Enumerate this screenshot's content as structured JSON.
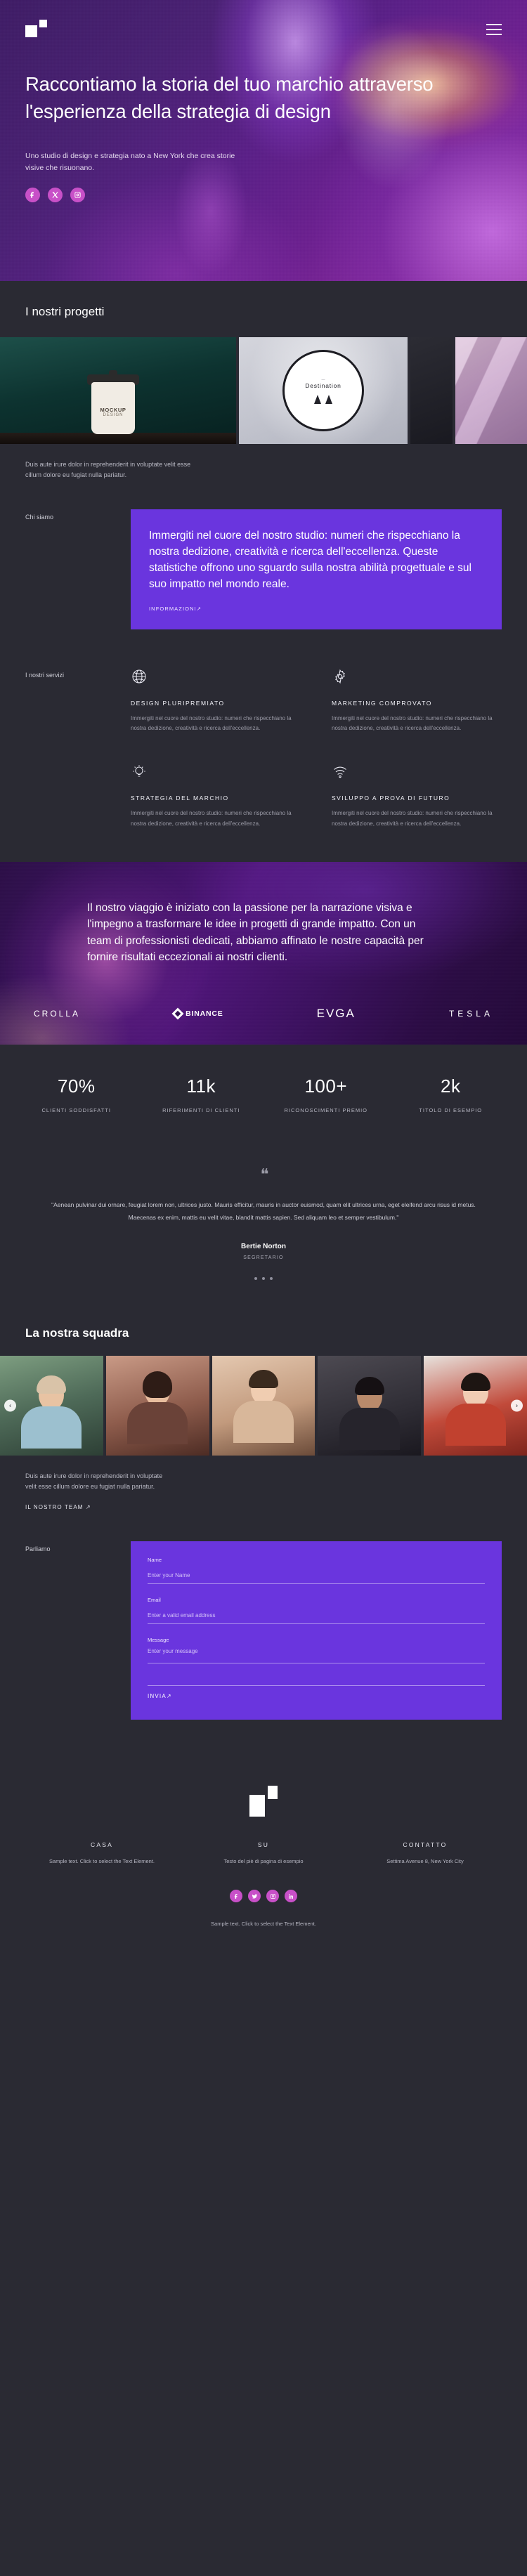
{
  "brand": {
    "logo_name": "studio-logo-mark"
  },
  "nav": {
    "menu_icon": "hamburger-menu-icon"
  },
  "hero": {
    "title": "Raccontiamo la storia del tuo marchio attraverso l'esperienza della strategia di design",
    "subtitle": "Uno studio di design e strategia nato a New York che crea storie visive che risuonano.",
    "socials": [
      {
        "name": "facebook-icon",
        "label": "Facebook"
      },
      {
        "name": "x-twitter-icon",
        "label": "X"
      },
      {
        "name": "instagram-icon",
        "label": "Instagram"
      }
    ]
  },
  "projects": {
    "heading": "I nostri progetti",
    "note": "Duis aute irure dolor in reprehenderit in voluptate velit esse cillum dolore eu fugiat nulla pariatur.",
    "cards": [
      {
        "name": "coffee-cup-photo",
        "cup_brand": "MOCKUP",
        "cup_sub": "DESIGN"
      },
      {
        "name": "destination-sign-photo",
        "sign_title": "Destination",
        "sign_sub": "— "
      },
      {
        "name": "dark-sliver-photo"
      },
      {
        "name": "pink-fabric-photo"
      }
    ]
  },
  "about": {
    "label": "Chi siamo",
    "body": "Immergiti nel cuore del nostro studio: numeri che rispecchiano la nostra dedizione, creatività e ricerca dell'eccellenza. Queste statistiche offrono uno sguardo sulla nostra abilità progettuale e sul suo impatto nel mondo reale.",
    "link": "INFORMAZIONI",
    "link_arrow": "↗"
  },
  "services": {
    "label": "I nostri servizi",
    "items": [
      {
        "icon": "globe-icon",
        "title": "DESIGN PLURIPREMIATO",
        "desc": "Immergiti nel cuore del nostro studio: numeri che rispecchiano la nostra dedizione, creatività e ricerca dell'eccellenza."
      },
      {
        "icon": "gear-icon",
        "title": "MARKETING COMPROVATO",
        "desc": "Immergiti nel cuore del nostro studio: numeri che rispecchiano la nostra dedizione, creatività e ricerca dell'eccellenza."
      },
      {
        "icon": "lightbulb-icon",
        "title": "STRATEGIA DEL MARCHIO",
        "desc": "Immergiti nel cuore del nostro studio: numeri che rispecchiano la nostra dedizione, creatività e ricerca dell'eccellenza."
      },
      {
        "icon": "wifi-signal-icon",
        "title": "SVILUPPO A PROVA DI FUTURO",
        "desc": "Immergiti nel cuore del nostro studio: numeri che rispecchiano la nostra dedizione, creatività e ricerca dell'eccellenza."
      }
    ]
  },
  "journey": {
    "text": "Il nostro viaggio è iniziato con la passione per la narrazione visiva e l'impegno a trasformare le idee in progetti di grande impatto. Con un team di professionisti dedicati, abbiamo affinato le nostre capacità per fornire risultati eccezionali ai nostri clienti.",
    "logos": [
      {
        "name": "crolla-logo",
        "label": "CROLLA"
      },
      {
        "name": "binance-logo",
        "label": "BINANCE"
      },
      {
        "name": "evga-logo",
        "label": "EVGA"
      },
      {
        "name": "tesla-logo",
        "label": "TESLA"
      }
    ]
  },
  "stats": [
    {
      "value": "70%",
      "label": "CLIENTI SODDISFATTI"
    },
    {
      "value": "11k",
      "label": "RIFERIMENTI DI CLIENTI"
    },
    {
      "value": "100+",
      "label": "RICONOSCIMENTI PREMIO"
    },
    {
      "value": "2k",
      "label": "TITOLO DI ESEMPIO"
    }
  ],
  "testimonial": {
    "quote_icon": "quote-mark-icon",
    "quote": "\"Aenean pulvinar dui ornare, feugiat lorem non, ultrices justo. Mauris efficitur, mauris in auctor euismod, quam elit ultrices urna, eget eleifend arcu risus id metus. Maecenas ex enim, mattis eu velit vitae, blandit mattis sapien. Sed aliquam leo et semper vestibulum.\"",
    "name": "Bertie Norton",
    "role": "SEGRETARIO"
  },
  "team": {
    "heading": "La nostra squadra",
    "note": "Duis aute irure dolor in reprehenderit in voluptate velit esse cillum dolore eu fugiat nulla pariatur.",
    "link": "IL NOSTRO TEAM",
    "link_arrow": "↗",
    "prev_icon": "chevron-left-icon",
    "next_icon": "chevron-right-icon",
    "members": [
      {
        "name": "team-photo-1"
      },
      {
        "name": "team-photo-2"
      },
      {
        "name": "team-photo-3"
      },
      {
        "name": "team-photo-4"
      },
      {
        "name": "team-photo-5"
      }
    ]
  },
  "contact": {
    "label": "Parliamo",
    "fields": [
      {
        "label": "Name",
        "placeholder": "Enter your Name",
        "value": ""
      },
      {
        "label": "Email",
        "placeholder": "Enter a valid email address",
        "value": ""
      },
      {
        "label": "Message",
        "placeholder": "Enter your message",
        "value": ""
      }
    ],
    "submit": "INVIA",
    "submit_arrow": "↗"
  },
  "footer": {
    "columns": [
      {
        "title": "CASA",
        "desc": "Sample text. Click to select the Text Element."
      },
      {
        "title": "SU",
        "desc": "Testo del piè di pagina di esempio"
      },
      {
        "title": "CONTATTO",
        "desc": "Settima Avenue 8, New York City"
      }
    ],
    "socials": [
      {
        "name": "facebook-icon"
      },
      {
        "name": "twitter-icon"
      },
      {
        "name": "instagram-icon"
      },
      {
        "name": "linkedin-icon"
      }
    ],
    "note": "Sample text. Click to select the Text Element."
  },
  "colors": {
    "accent_purple": "#6a35de",
    "social_pink": "#c850c8",
    "page_bg": "#2a2a33"
  }
}
